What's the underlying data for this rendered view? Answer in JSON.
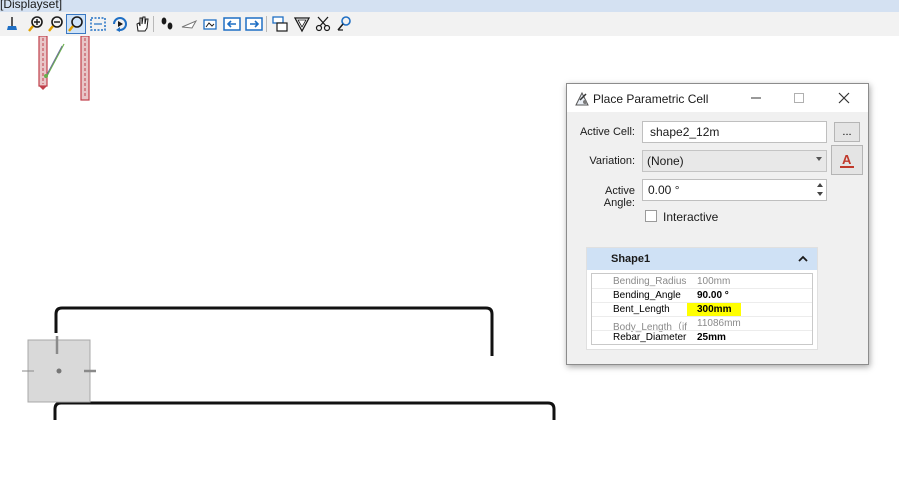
{
  "window": {
    "title": "[Displayset]"
  },
  "toolbar": {
    "buttons": [
      "brush-icon",
      "zoom-in-icon",
      "zoom-out-icon",
      "window-area-icon",
      "fit-view-icon",
      "rotate-view-icon",
      "pan-view-icon",
      "walk-icon",
      "fly-icon",
      "view-previous-icon",
      "view-next-icon",
      "copy-view-icon",
      "clip-volume-icon",
      "clip-mask-icon",
      "camera-icon"
    ],
    "active_button": "window-area-icon"
  },
  "dialog": {
    "title": "Place Parametric Cell",
    "active_cell_label": "Active Cell:",
    "active_cell_value": "shape2_12m",
    "browse_label": "...",
    "variation_label": "Variation:",
    "variation_value": "(None)",
    "active_angle_label": "Active Angle:",
    "active_angle_value": "0.00 °",
    "interactive_label": "Interactive",
    "interactive_checked": false,
    "panel": {
      "title": "Shape1",
      "rows": [
        {
          "name": "Bending_Radius",
          "value": "100mm",
          "state": "disabled"
        },
        {
          "name": "Bending_Angle",
          "value": "90.00 °",
          "state": "normal"
        },
        {
          "name": "Bent_Length",
          "value": "300mm",
          "state": "highlighted"
        },
        {
          "name": "Body_Length（if",
          "value": "11086mm",
          "state": "disabled"
        },
        {
          "name": "Rebar_Diameter",
          "value": "25mm",
          "state": "normal"
        }
      ]
    }
  },
  "colors": {
    "highlight": "#ffff00",
    "panel_header": "#cfe1f5",
    "rebar_red": "#c0404b",
    "toolbar_blue": "#1f6fc4"
  }
}
